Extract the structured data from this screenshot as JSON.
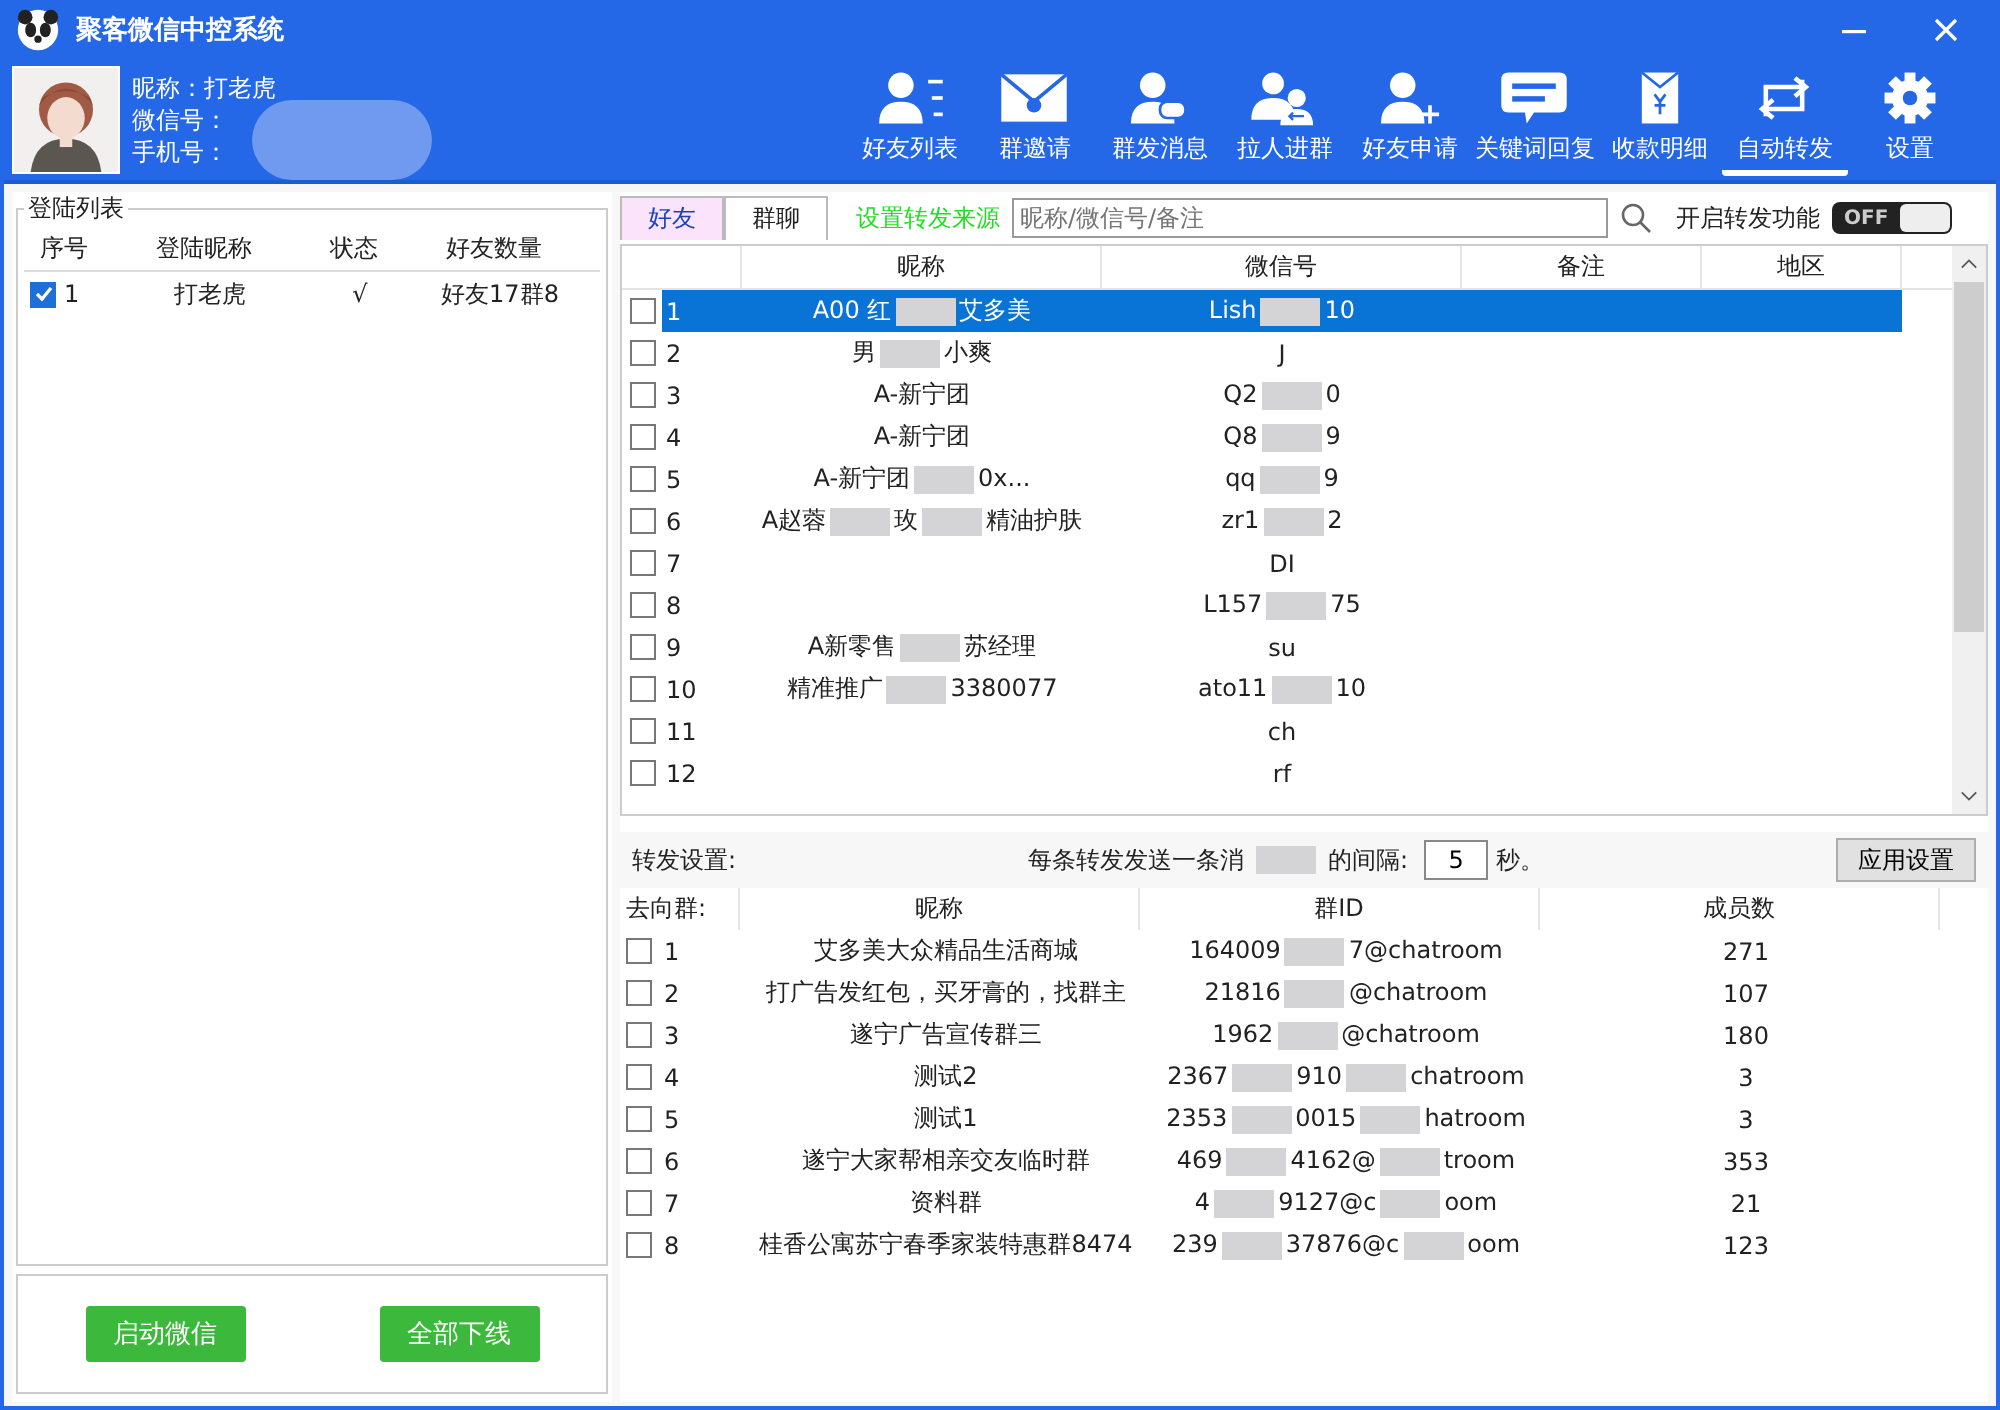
{
  "window": {
    "title": "聚客微信中控系统"
  },
  "account": {
    "nickname": "昵称：打老虎",
    "wechat_id": "微信号：",
    "phone": "手机号："
  },
  "nav": [
    {
      "label": "好友列表",
      "selected": false
    },
    {
      "label": "群邀请",
      "selected": false
    },
    {
      "label": "群发消息",
      "selected": false
    },
    {
      "label": "拉人进群",
      "selected": false
    },
    {
      "label": "好友申请",
      "selected": false
    },
    {
      "label": "关键词回复",
      "selected": false
    },
    {
      "label": "收款明细",
      "selected": false
    },
    {
      "label": "自动转发",
      "selected": true
    },
    {
      "label": "设置",
      "selected": false
    }
  ],
  "login_list": {
    "title": "登陆列表",
    "columns": [
      "序号",
      "登陆昵称",
      "状态",
      "好友数量"
    ],
    "rows": [
      {
        "checked": true,
        "no": "1",
        "nickname": "打老虎",
        "status": "√",
        "count": "好友17群8"
      }
    ],
    "buttons": [
      "启动微信",
      "全部下线"
    ]
  },
  "tabs": [
    {
      "label": "好友",
      "selected": true
    },
    {
      "label": "群聊",
      "selected": false
    }
  ],
  "source_link": "设置转发来源",
  "search": {
    "placeholder": "昵称/微信号/备注"
  },
  "forward_switch": {
    "label": "开启转发功能",
    "on": false,
    "state_text": "OFF"
  },
  "friends": {
    "columns": [
      "昵称",
      "微信号",
      "备注",
      "地区"
    ],
    "rows": [
      {
        "checked": false,
        "selected": true,
        "no": "1",
        "nickname": [
          "A00 红",
          "艾多美"
        ],
        "wechat_id": [
          "Lish",
          "10"
        ]
      },
      {
        "checked": false,
        "selected": false,
        "no": "2",
        "nickname": [
          "男",
          "小爽"
        ],
        "wechat_id": [
          "J"
        ]
      },
      {
        "checked": false,
        "selected": false,
        "no": "3",
        "nickname": [
          "A-新宁团"
        ],
        "wechat_id": [
          "Q2",
          "0"
        ]
      },
      {
        "checked": false,
        "selected": false,
        "no": "4",
        "nickname": [
          "A-新宁团"
        ],
        "wechat_id": [
          "Q8",
          "9"
        ]
      },
      {
        "checked": false,
        "selected": false,
        "no": "5",
        "nickname": [
          "A-新宁团",
          "0x..."
        ],
        "wechat_id": [
          "qq",
          "9"
        ]
      },
      {
        "checked": false,
        "selected": false,
        "no": "6",
        "nickname": [
          "A赵蓉",
          "玫",
          "精油护肤"
        ],
        "wechat_id": [
          "zr1",
          "2"
        ]
      },
      {
        "checked": false,
        "selected": false,
        "no": "7",
        "nickname": [],
        "wechat_id": [
          "DI"
        ]
      },
      {
        "checked": false,
        "selected": false,
        "no": "8",
        "nickname": [],
        "wechat_id": [
          "L157",
          "75"
        ]
      },
      {
        "checked": false,
        "selected": false,
        "no": "9",
        "nickname": [
          "A新零售",
          "苏经理"
        ],
        "wechat_id": [
          "su"
        ]
      },
      {
        "checked": false,
        "selected": false,
        "no": "10",
        "nickname": [
          "精准推广",
          "3380077"
        ],
        "wechat_id": [
          "ato11",
          "10"
        ]
      },
      {
        "checked": false,
        "selected": false,
        "no": "11",
        "nickname": [],
        "wechat_id": [
          "ch"
        ]
      },
      {
        "checked": false,
        "selected": false,
        "no": "12",
        "nickname": [],
        "wechat_id": [
          "rf"
        ]
      }
    ]
  },
  "forward_settings": {
    "label": "转发设置:",
    "interval_label": [
      "每条转发发送一条消",
      "的间隔:"
    ],
    "interval": "5",
    "unit": "秒。",
    "apply_button": "应用设置"
  },
  "groups": {
    "columns": [
      "去向群:",
      "昵称",
      "群ID",
      "成员数"
    ],
    "rows": [
      {
        "checked": false,
        "no": "1",
        "name": "艾多美大众精品生活商城",
        "group_id": [
          "164009",
          "7@chatroom"
        ],
        "members": "271"
      },
      {
        "checked": false,
        "no": "2",
        "name": "打广告发红包，买牙膏的，找群主",
        "group_id": [
          "21816",
          "@chatroom"
        ],
        "members": "107"
      },
      {
        "checked": false,
        "no": "3",
        "name": "遂宁广告宣传群三",
        "group_id": [
          "1962",
          "@chatroom"
        ],
        "members": "180"
      },
      {
        "checked": false,
        "no": "4",
        "name": "测试2",
        "group_id": [
          "2367",
          "910",
          "chatroom"
        ],
        "members": "3"
      },
      {
        "checked": false,
        "no": "5",
        "name": "测试1",
        "group_id": [
          "2353",
          "0015",
          "hatroom"
        ],
        "members": "3"
      },
      {
        "checked": false,
        "no": "6",
        "name": "遂宁大家帮相亲交友临时群",
        "group_id": [
          "469",
          "4162@",
          "troom"
        ],
        "members": "353"
      },
      {
        "checked": false,
        "no": "7",
        "name": "资料群",
        "group_id": [
          "4",
          "9127@c",
          "oom"
        ],
        "members": "21"
      },
      {
        "checked": false,
        "no": "8",
        "name": "桂香公寓苏宁春季家装特惠群8474",
        "group_id": [
          "239",
          "37876@c",
          "oom"
        ],
        "members": "123"
      }
    ]
  }
}
